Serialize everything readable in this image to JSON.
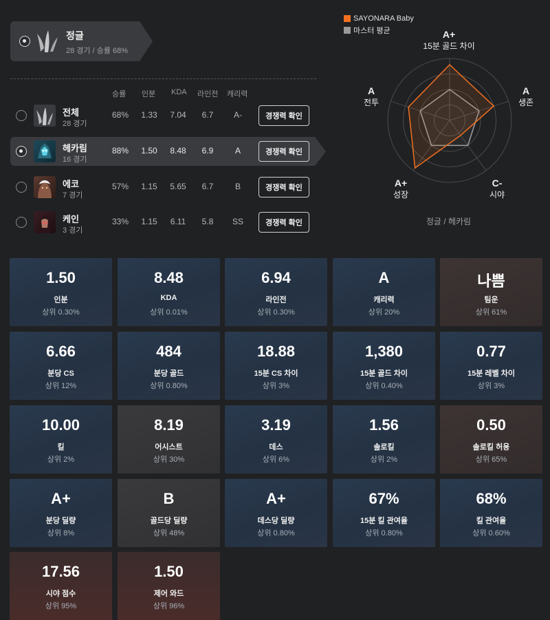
{
  "role": {
    "title": "정글",
    "subtitle": "28 경기 / 승률 68%",
    "icon": "jungle-claw-icon"
  },
  "table": {
    "headers": [
      "승률",
      "인분",
      "KDA",
      "라인전",
      "캐리력"
    ],
    "rows": [
      {
        "name": "전체",
        "games": "28 경기",
        "winrate": "68%",
        "inbun": "1.33",
        "kda": "7.04",
        "lane": "6.7",
        "carry": "A-",
        "button": "경쟁력 확인",
        "selected": false,
        "icon": "jungle-claw-icon"
      },
      {
        "name": "헤카림",
        "games": "16 경기",
        "winrate": "88%",
        "inbun": "1.50",
        "kda": "8.48",
        "lane": "6.9",
        "carry": "A",
        "button": "경쟁력 확인",
        "selected": true,
        "icon": "hecarim-portrait"
      },
      {
        "name": "에코",
        "games": "7 경기",
        "winrate": "57%",
        "inbun": "1.15",
        "kda": "5.65",
        "lane": "6.7",
        "carry": "B",
        "button": "경쟁력 확인",
        "selected": false,
        "icon": "ekko-portrait"
      },
      {
        "name": "케인",
        "games": "3 경기",
        "winrate": "33%",
        "inbun": "1.15",
        "kda": "6.11",
        "lane": "5.8",
        "carry": "SS",
        "button": "경쟁력 확인",
        "selected": false,
        "icon": "kayn-portrait"
      }
    ]
  },
  "radar": {
    "legend": [
      {
        "label": "SAYONARA Baby",
        "color": "#f07020"
      },
      {
        "label": "마스터 평균",
        "color": "#9a9a9a"
      }
    ],
    "axes": [
      {
        "grade": "A+",
        "label": "15분 골드 차이"
      },
      {
        "grade": "A",
        "label": "생존"
      },
      {
        "grade": "C-",
        "label": "시야"
      },
      {
        "grade": "A+",
        "label": "성장"
      },
      {
        "grade": "A",
        "label": "전투"
      }
    ],
    "player_values": [
      0.9,
      0.75,
      0.3,
      0.95,
      0.7
    ],
    "average_values": [
      0.5,
      0.5,
      0.5,
      0.5,
      0.5
    ],
    "caption": "정글 / 헤카림"
  },
  "cards": [
    {
      "value": "1.50",
      "label": "인분",
      "pct": "상위 0.30%",
      "tone": "blue"
    },
    {
      "value": "8.48",
      "label": "KDA",
      "pct": "상위 0.01%",
      "tone": "blue"
    },
    {
      "value": "6.94",
      "label": "라인전",
      "pct": "상위 0.30%",
      "tone": "blue"
    },
    {
      "value": "A",
      "label": "캐리력",
      "pct": "상위 20%",
      "tone": "blue"
    },
    {
      "value": "나쁨",
      "label": "팀운",
      "pct": "상위 61%",
      "tone": "brown"
    },
    {
      "value": "6.66",
      "label": "분당 CS",
      "pct": "상위 12%",
      "tone": "blue"
    },
    {
      "value": "484",
      "label": "분당 골드",
      "pct": "상위 0.80%",
      "tone": "blue"
    },
    {
      "value": "18.88",
      "label": "15분 CS 차이",
      "pct": "상위 3%",
      "tone": "blue"
    },
    {
      "value": "1,380",
      "label": "15분 골드 차이",
      "pct": "상위 0.40%",
      "tone": "blue"
    },
    {
      "value": "0.77",
      "label": "15분 레벨 차이",
      "pct": "상위 3%",
      "tone": "blue"
    },
    {
      "value": "10.00",
      "label": "킬",
      "pct": "상위 2%",
      "tone": "blue"
    },
    {
      "value": "8.19",
      "label": "어시스트",
      "pct": "상위 30%",
      "tone": "gray"
    },
    {
      "value": "3.19",
      "label": "데스",
      "pct": "상위 6%",
      "tone": "blue"
    },
    {
      "value": "1.56",
      "label": "솔로킬",
      "pct": "상위 2%",
      "tone": "blue"
    },
    {
      "value": "0.50",
      "label": "솔로킬 허용",
      "pct": "상위 65%",
      "tone": "brown"
    },
    {
      "value": "A+",
      "label": "분당 딜량",
      "pct": "상위 8%",
      "tone": "blue"
    },
    {
      "value": "B",
      "label": "골드당 딜량",
      "pct": "상위 48%",
      "tone": "gray"
    },
    {
      "value": "A+",
      "label": "데스당 딜량",
      "pct": "상위 0.80%",
      "tone": "blue"
    },
    {
      "value": "67%",
      "label": "15분 킬 관여율",
      "pct": "상위 0.80%",
      "tone": "blue"
    },
    {
      "value": "68%",
      "label": "킬 관여율",
      "pct": "상위 0.60%",
      "tone": "blue"
    },
    {
      "value": "17.56",
      "label": "시야 점수",
      "pct": "상위 95%",
      "tone": "red"
    },
    {
      "value": "1.50",
      "label": "제어 와드",
      "pct": "상위 96%",
      "tone": "red"
    }
  ]
}
